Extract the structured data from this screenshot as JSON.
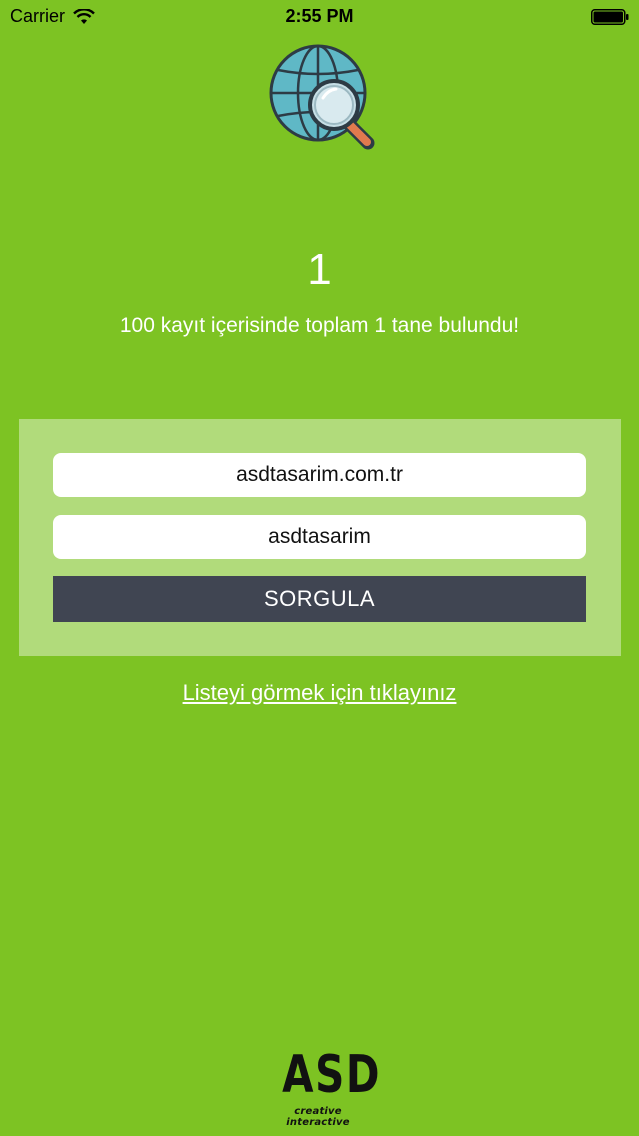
{
  "status_bar": {
    "carrier": "Carrier",
    "time": "2:55 PM"
  },
  "result": {
    "count": "1",
    "message": "100 kayıt içerisinde toplam 1 tane bulundu!"
  },
  "form": {
    "domain_value": "asdtasarim.com.tr",
    "keyword_value": "asdtasarim",
    "submit_label": "SORGULA"
  },
  "list_link": "Listeyi görmek için tıklayınız",
  "brand": {
    "letters": "ASD",
    "tagline": "creative interactive"
  },
  "colors": {
    "background": "#7dc323",
    "button": "#404552"
  },
  "icons": [
    "wifi-icon",
    "battery-icon",
    "globe-search-icon"
  ]
}
